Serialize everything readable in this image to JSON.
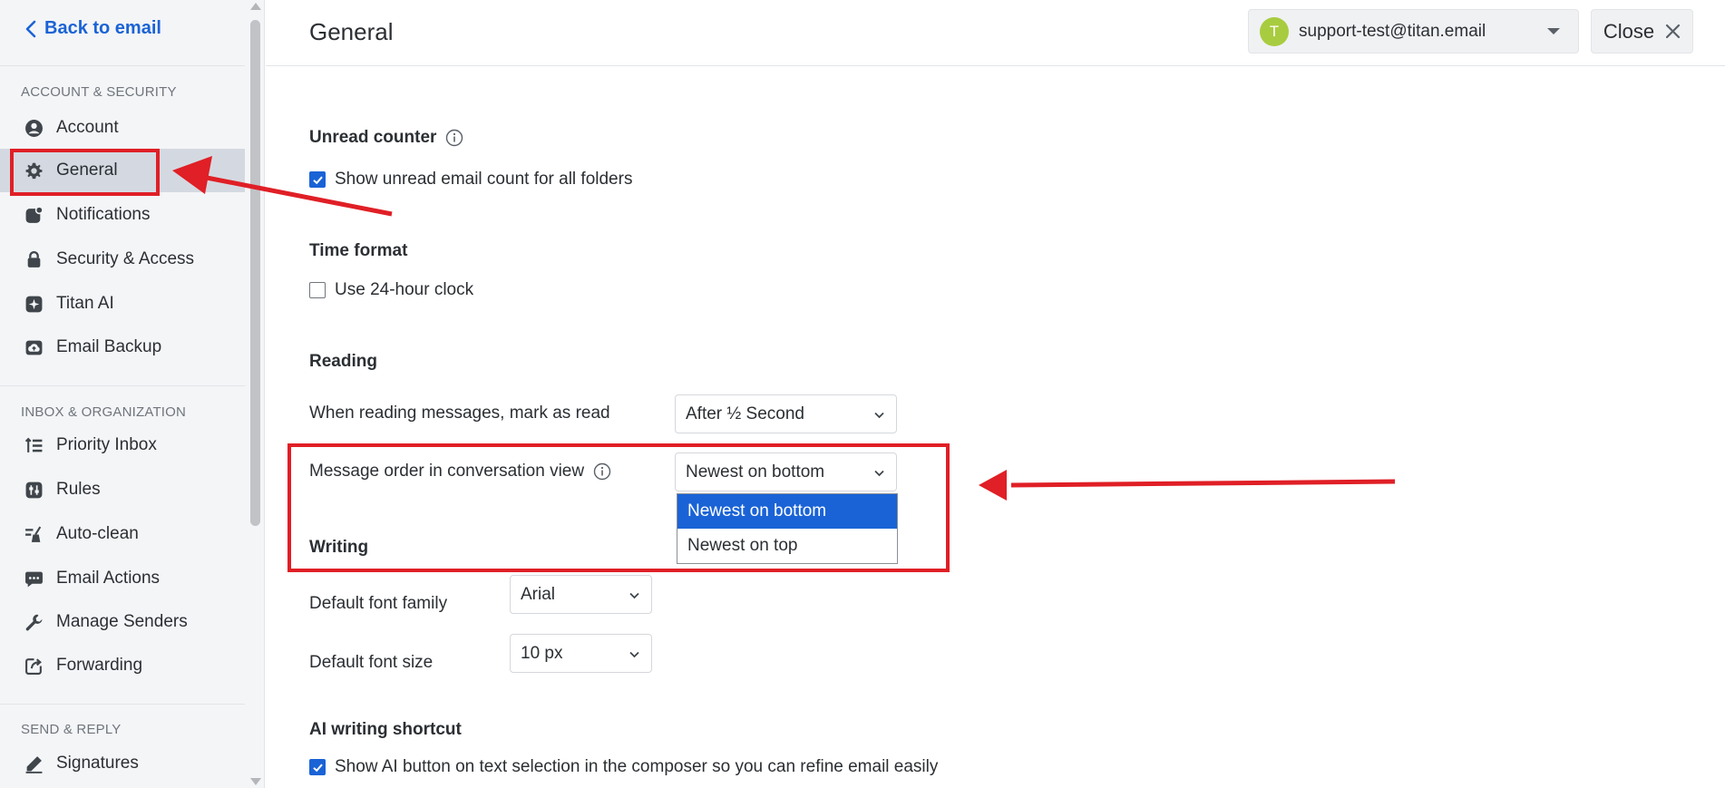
{
  "sidebar": {
    "back_label": "Back to email",
    "sections": {
      "account_security": "ACCOUNT & SECURITY",
      "inbox_organization": "INBOX & ORGANIZATION",
      "send_reply": "SEND & REPLY"
    },
    "items": [
      {
        "label": "Account",
        "icon": "user-circle-icon"
      },
      {
        "label": "General",
        "icon": "gear-icon",
        "active": true
      },
      {
        "label": "Notifications",
        "icon": "notification-badge-icon"
      },
      {
        "label": "Security & Access",
        "icon": "lock-icon"
      },
      {
        "label": "Titan AI",
        "icon": "sparkle-icon"
      },
      {
        "label": "Email Backup",
        "icon": "cloud-upload-icon"
      },
      {
        "label": "Priority Inbox",
        "icon": "priority-list-icon"
      },
      {
        "label": "Rules",
        "icon": "rules-icon"
      },
      {
        "label": "Auto-clean",
        "icon": "broom-icon"
      },
      {
        "label": "Email Actions",
        "icon": "chat-dots-icon"
      },
      {
        "label": "Manage Senders",
        "icon": "wrench-icon"
      },
      {
        "label": "Forwarding",
        "icon": "forward-icon"
      },
      {
        "label": "Signatures",
        "icon": "pen-icon"
      }
    ]
  },
  "header": {
    "title": "General",
    "account": {
      "avatar_letter": "T",
      "email": "support-test@titan.email"
    },
    "close_label": "Close"
  },
  "main": {
    "unread_counter": {
      "title": "Unread counter",
      "checkbox_label": "Show unread email count for all folders",
      "checked": true
    },
    "time_format": {
      "title": "Time format",
      "checkbox_label": "Use 24-hour clock",
      "checked": false
    },
    "reading": {
      "title": "Reading",
      "mark_as_read_label": "When reading messages, mark as read",
      "mark_as_read_value": "After ½ Second",
      "message_order_label": "Message order in conversation view",
      "message_order_value": "Newest on bottom",
      "message_order_options": [
        "Newest on bottom",
        "Newest on top"
      ]
    },
    "writing": {
      "title": "Writing",
      "font_family_label": "Default font family",
      "font_family_value": "Arial",
      "font_size_label": "Default font size",
      "font_size_value": "10 px"
    },
    "ai_shortcut": {
      "title": "AI writing shortcut",
      "checkbox_label": "Show AI button on text selection in the composer so you can refine email easily",
      "checked": true
    }
  },
  "colors": {
    "accent": "#1a63d6",
    "annotation": "#e01f26",
    "avatar": "#a8cc3f",
    "sidebar_bg": "#f4f5f7",
    "active_item_bg": "#d4d9e1"
  }
}
